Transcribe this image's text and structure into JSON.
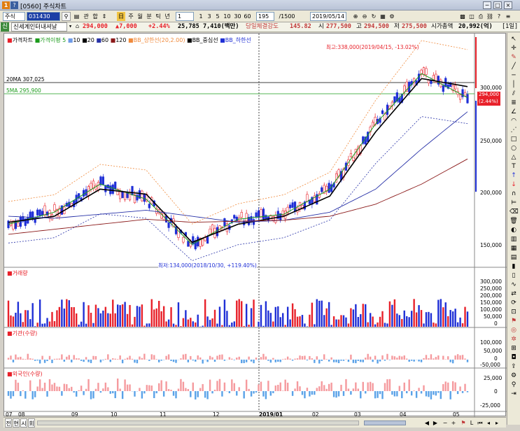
{
  "window": {
    "code": "[0560]",
    "title": "주식차트",
    "buttons": [
      "─",
      "□",
      "×"
    ]
  },
  "toolbar": {
    "market": "주식",
    "code_value": "031430",
    "btn_gwan": "관",
    "btn_hap": "합",
    "periods": [
      "주",
      "월",
      "분",
      "틱",
      "년"
    ],
    "min_value": "1",
    "intervals": [
      "1",
      "3",
      "5",
      "10",
      "30",
      "60"
    ],
    "count_value": "195",
    "count_total": "/1500",
    "date_value": "2019/05/14"
  },
  "infobar": {
    "tab": "신",
    "name": "신세계인터내셔날",
    "price": "294,000",
    "change": "▲7,000",
    "rate": "+2.44%",
    "volume": "25,785",
    "amount": "7,410(백만)",
    "strength_label": "당일체결강도",
    "strength": "145.82",
    "open_label": "시",
    "open": "277,500",
    "high_label": "고",
    "high": "294,500",
    "low_label": "저",
    "low": "275,500",
    "mcap_label": "시가총액",
    "mcap": "20,992(억)",
    "period": "[1일]"
  },
  "legend": {
    "main": [
      "가격차트",
      "가격이평",
      "5",
      "10",
      "20",
      "60",
      "120",
      "BB_상한선(20,2.00)",
      "BB_중심선",
      "BB_하한선"
    ],
    "volume": "거래량",
    "inst": "기관(수량)",
    "foreign": "외국인(수량)"
  },
  "annotations": {
    "high": "최고:338,000(2019/04/15, -13.02%)",
    "low": "최저:134,000(2018/10/30, +119.40%)",
    "ma20": "20MA 307,025",
    "ma5": "5MA 295,900",
    "price_tag": "294,000",
    "price_tag_rate": "(2.44%)"
  },
  "price_axis": [
    "300,000",
    "250,000",
    "200,000",
    "150,000"
  ],
  "volume_axis": [
    "300,000",
    "250,000",
    "200,000",
    "150,000",
    "100,000",
    "50,000",
    "0"
  ],
  "inst_axis": [
    "100,000",
    "50,000",
    "0",
    "-50,000"
  ],
  "foreign_axis": [
    "25,000",
    "0",
    "-25,000"
  ],
  "x_axis": [
    "07",
    "08",
    "09",
    "10",
    "11",
    "12",
    "2019/01",
    "02",
    "03",
    "04",
    "05"
  ],
  "bottom_tabs": [
    "전",
    "현",
    "시",
    "회"
  ],
  "colors": {
    "up": "#e8212a",
    "down": "#1f2fd6",
    "ma5": "#1c9b1c",
    "ma10": "#6e9ae6",
    "ma20": "#000000",
    "ma60": "#2832a8",
    "ma120": "#8b1a1a",
    "bb": "#f08a3c"
  },
  "chart_data": {
    "type": "line",
    "title": "",
    "x": [
      "2018-07",
      "2018-08",
      "2018-09",
      "2018-10",
      "2018-11",
      "2018-12",
      "2019-01",
      "2019-02",
      "2019-03",
      "2019-04",
      "2019-05"
    ],
    "series": [
      {
        "name": "5",
        "values": [
          170000,
          182000,
          210000,
          195000,
          150000,
          175000,
          180000,
          205000,
          270000,
          320000,
          296000
        ]
      },
      {
        "name": "20",
        "values": [
          172000,
          178000,
          205000,
          200000,
          152000,
          170000,
          178000,
          198000,
          262000,
          315000,
          307000
        ]
      },
      {
        "name": "60",
        "values": [
          178000,
          176000,
          180000,
          184000,
          178000,
          172000,
          174000,
          182000,
          205000,
          245000,
          282000
        ]
      },
      {
        "name": "120",
        "values": [
          160000,
          165000,
          170000,
          175000,
          172000,
          173000,
          174000,
          178000,
          190000,
          210000,
          235000
        ]
      }
    ],
    "ylim": [
      130000,
      350000
    ]
  }
}
